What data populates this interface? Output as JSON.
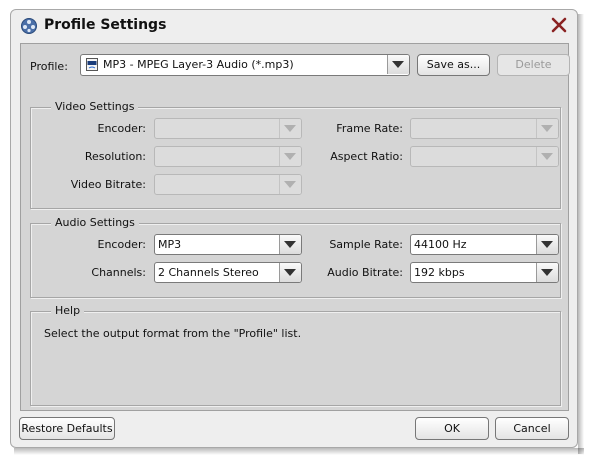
{
  "window": {
    "title": "Profile Settings"
  },
  "profile": {
    "label": "Profile:",
    "value": "MP3 - MPEG Layer-3 Audio (*.mp3)",
    "save_as": "Save as...",
    "delete": "Delete"
  },
  "video": {
    "title": "Video Settings",
    "encoder_label": "Encoder:",
    "resolution_label": "Resolution:",
    "video_bitrate_label": "Video Bitrate:",
    "frame_rate_label": "Frame Rate:",
    "aspect_ratio_label": "Aspect Ratio:"
  },
  "audio": {
    "title": "Audio Settings",
    "encoder_label": "Encoder:",
    "encoder_value": "MP3",
    "channels_label": "Channels:",
    "channels_value": "2 Channels Stereo",
    "sample_rate_label": "Sample Rate:",
    "sample_rate_value": "44100 Hz",
    "audio_bitrate_label": "Audio Bitrate:",
    "audio_bitrate_value": "192 kbps"
  },
  "help": {
    "title": "Help",
    "text": "Select the output format from the \"Profile\" list."
  },
  "footer": {
    "restore": "Restore Defaults",
    "ok": "OK",
    "cancel": "Cancel"
  }
}
